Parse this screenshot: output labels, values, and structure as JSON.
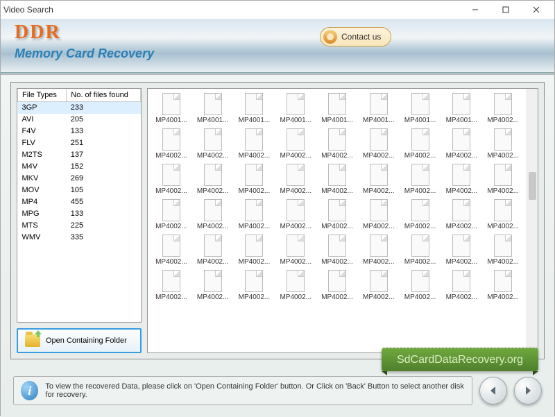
{
  "window": {
    "title": "Video Search"
  },
  "header": {
    "brand": "DDR",
    "subtitle": "Memory Card Recovery",
    "contact_label": "Contact us"
  },
  "table": {
    "col1": "File Types",
    "col2": "No. of files found",
    "rows": [
      {
        "type": "3GP",
        "count": "233"
      },
      {
        "type": "AVI",
        "count": "205"
      },
      {
        "type": "F4V",
        "count": "133"
      },
      {
        "type": "FLV",
        "count": "251"
      },
      {
        "type": "M2TS",
        "count": "137"
      },
      {
        "type": "M4V",
        "count": "152"
      },
      {
        "type": "MKV",
        "count": "269"
      },
      {
        "type": "MOV",
        "count": "105"
      },
      {
        "type": "MP4",
        "count": "455"
      },
      {
        "type": "MPG",
        "count": "133"
      },
      {
        "type": "MTS",
        "count": "225"
      },
      {
        "type": "WMV",
        "count": "335"
      }
    ]
  },
  "open_folder_label": "Open Containing Folder",
  "files": {
    "labels": [
      "MP4001...",
      "MP4001...",
      "MP4001...",
      "MP4001...",
      "MP4001...",
      "MP4001...",
      "MP4001...",
      "MP4001...",
      "MP4002...",
      "MP4002...",
      "MP4002...",
      "MP4002...",
      "MP4002...",
      "MP4002...",
      "MP4002...",
      "MP4002...",
      "MP4002...",
      "MP4002...",
      "MP4002...",
      "MP4002...",
      "MP4002...",
      "MP4002...",
      "MP4002...",
      "MP4002...",
      "MP4002...",
      "MP4002...",
      "MP4002...",
      "MP4002...",
      "MP4002...",
      "MP4002...",
      "MP4002...",
      "MP4002...",
      "MP4002...",
      "MP4002...",
      "MP4002...",
      "MP4002...",
      "MP4002...",
      "MP4002...",
      "MP4002...",
      "MP4002...",
      "MP4002...",
      "MP4002...",
      "MP4002...",
      "MP4002...",
      "MP4002...",
      "MP4002...",
      "MP4002...",
      "MP4002...",
      "MP4002...",
      "MP4002...",
      "MP4002...",
      "MP4002...",
      "MP4002...",
      "MP4002..."
    ]
  },
  "banner": "SdCardDataRecovery.org",
  "info_text": "To view the recovered Data, please click on 'Open Containing Folder' button. Or Click on 'Back' Button to select another disk for recovery."
}
